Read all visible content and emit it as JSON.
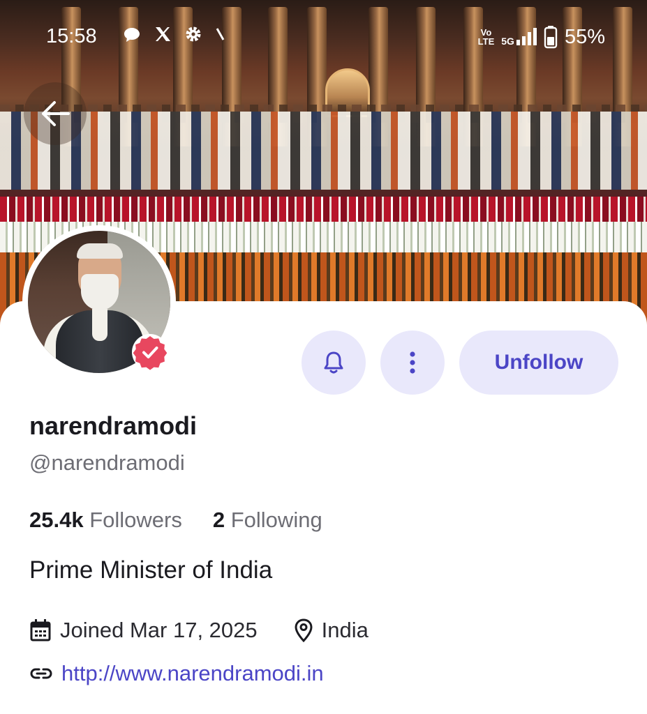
{
  "status_bar": {
    "time": "15:58",
    "left_icons": [
      "chat-bubble-icon",
      "x-logo-icon",
      "gear-icon",
      "slash-icon"
    ],
    "volte_top": "Vo",
    "volte_bottom": "LTE",
    "network": "5G",
    "battery": "55%"
  },
  "profile": {
    "display_name": "narendramodi",
    "handle": "@narendramodi",
    "followers_count": "25.4k",
    "followers_label": "Followers",
    "following_count": "2",
    "following_label": "Following",
    "bio": "Prime Minister of India",
    "joined": "Joined Mar 17, 2025",
    "location": "India",
    "website": "http://www.narendramodi.in",
    "verified": true
  },
  "actions": {
    "unfollow_label": "Unfollow"
  },
  "colors": {
    "accent": "#4b45c6",
    "button_bg": "#e9e8fb",
    "verified_badge": "#e8475f",
    "text_primary": "#1a1a1f",
    "text_secondary": "#6d6d74"
  }
}
